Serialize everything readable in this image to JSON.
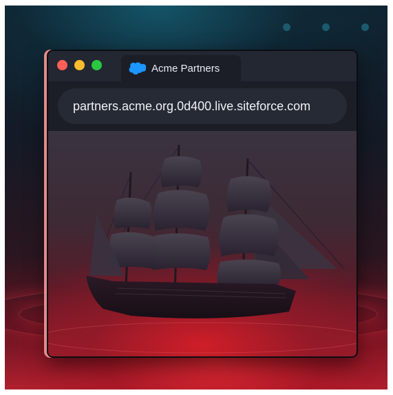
{
  "decor": {
    "dots": 3,
    "accent_dot_color": "#1c5a6e",
    "glow_color": "#e0283a"
  },
  "window": {
    "controls": [
      "close",
      "minimize",
      "maximize"
    ],
    "tab": {
      "icon": "salesforce-cloud-icon",
      "title": "Acme Partners"
    },
    "address_bar": {
      "url": "partners.acme.org.0d400.live.siteforce.com"
    },
    "content": {
      "illustration": "sailing-ship-icon"
    }
  },
  "colors": {
    "close": "#ff5f57",
    "minimize": "#febc2e",
    "maximize": "#28c840",
    "brand_cloud": "#1b96ff"
  }
}
